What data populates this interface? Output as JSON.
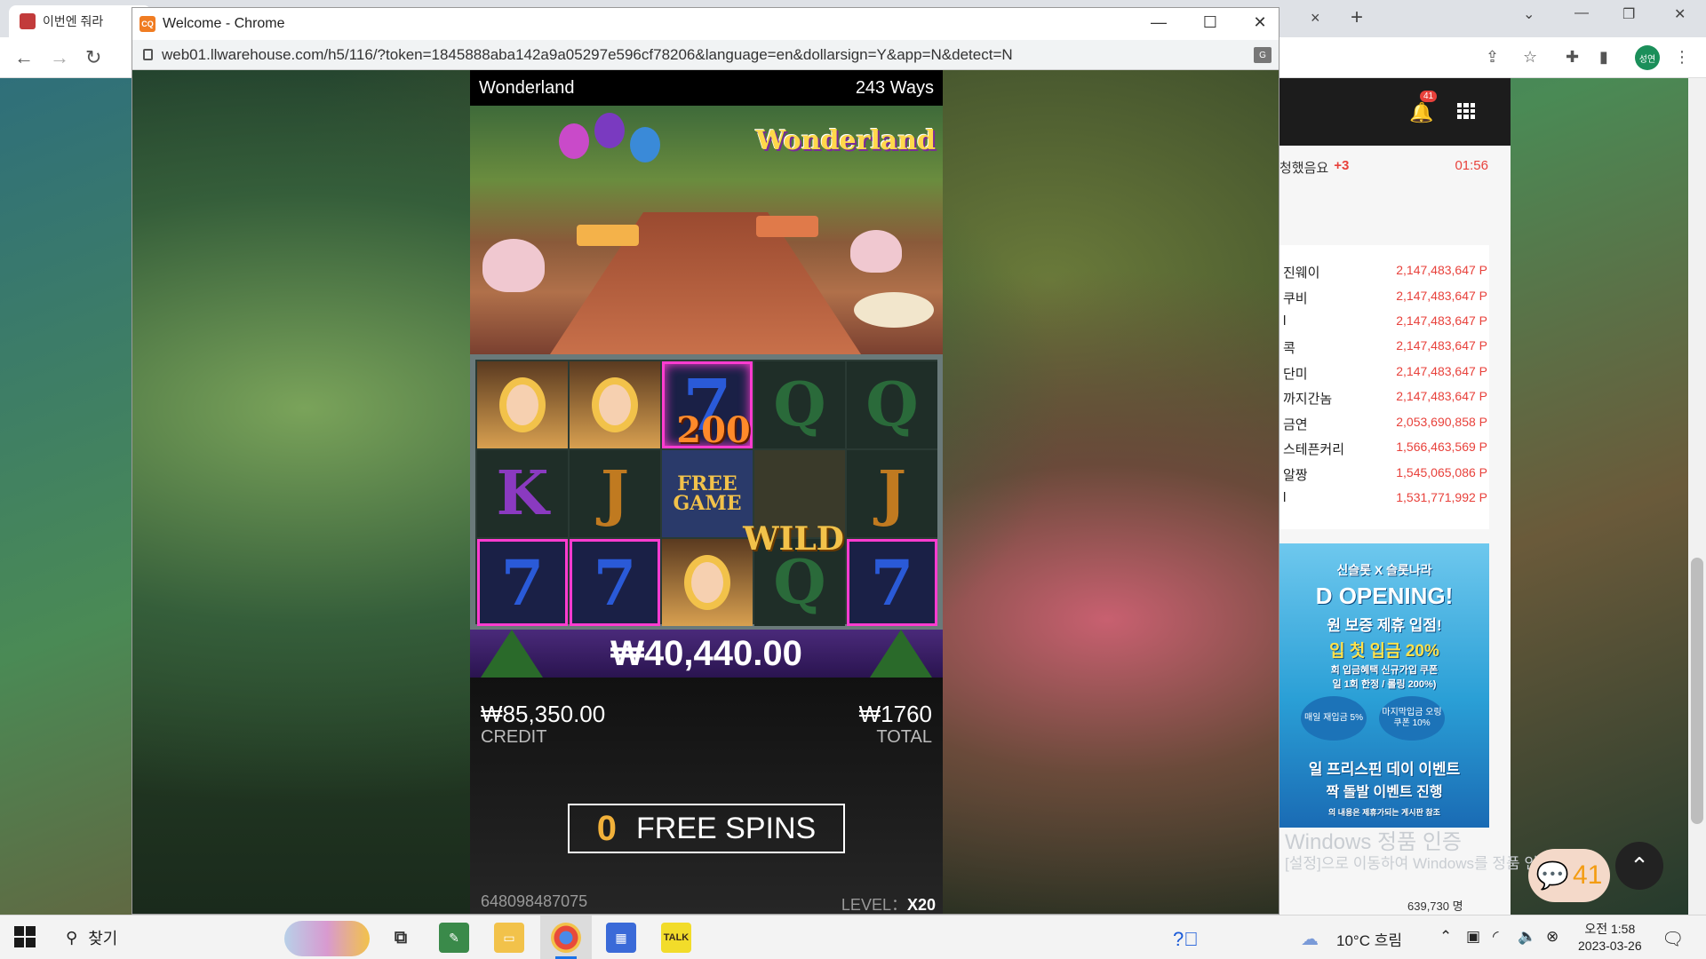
{
  "background_browser": {
    "tab_title": "이번엔 줘라",
    "tab_close": "×",
    "new_tab": "+",
    "nav_back": "←",
    "nav_forward": "→",
    "nav_reload": "↻",
    "avatar_text": "성연",
    "window_minimize": "—",
    "window_restore": "❐",
    "window_close": "✕"
  },
  "site": {
    "notification_count": "41",
    "notice": {
      "text": "청했음요",
      "plus": "+3",
      "time": "01:56"
    },
    "ranking": [
      {
        "name": "진웨이",
        "points": "2,147,483,647 P"
      },
      {
        "name": "쿠비",
        "points": "2,147,483,647 P"
      },
      {
        "name": "l",
        "points": "2,147,483,647 P"
      },
      {
        "name": "콕",
        "points": "2,147,483,647 P"
      },
      {
        "name": "단미",
        "points": "2,147,483,647 P"
      },
      {
        "name": "까지간놈",
        "points": "2,147,483,647 P"
      },
      {
        "name": "금연",
        "points": "2,053,690,858 P"
      },
      {
        "name": "스테픈커리",
        "points": "1,566,463,569 P"
      },
      {
        "name": "알짱",
        "points": "1,545,065,086 P"
      },
      {
        "name": "l",
        "points": "1,531,771,992 P"
      }
    ],
    "banner": {
      "line1": "신슬롯 X 슬롯나라",
      "line2": "D OPENING!",
      "line3": "원 보증 제휴 입점!",
      "line4": "입 첫 입금 20%",
      "line5": "회 입금혜택 신규가입 쿠폰",
      "line6": "일 1회 한정 / 롤링 200%)",
      "circle1": "매일 재입금 5%",
      "circle2": "마지막입금 오링쿠폰 10%",
      "line7": "일 프리스핀 데이 이벤트",
      "line8": "짝 돌발 이벤트 진행",
      "line9": "의 내용은 제휴가되는 게시판 참조"
    },
    "windows_activation_title": "Windows 정품 인증",
    "windows_activation_text": "[설정]으로 이동하여 Windows를 정품 인증합니다.",
    "chat_count": "41",
    "member_count": "639,730 명"
  },
  "popup": {
    "title": "Welcome - Chrome",
    "url": "web01.llwarehouse.com/h5/116/?token=1845888aba142a9a05297e596cf78206&language=en&dollarsign=Y&app=N&detect=N",
    "favicon": "CQ",
    "translate_icon": "G"
  },
  "game": {
    "name": "Wonderland",
    "ways": "243 Ways",
    "logo": "Wonderland",
    "win_amount_small": "200",
    "wild_label": "WILD",
    "free_game_label": "FREE GAME",
    "win_total": "₩40,440.00",
    "credit_value": "₩85,350.00",
    "credit_label": "CREDIT",
    "total_value": "₩1760",
    "total_label": "TOTAL",
    "free_spins_count": "0",
    "free_spins_label": "FREE SPINS",
    "game_id": "648098487075",
    "level_label": "LEVEL：",
    "level_value": "X20",
    "reels": [
      [
        "alice",
        "K",
        "7"
      ],
      [
        "alice",
        "J",
        "7"
      ],
      [
        "7",
        "free",
        "alice"
      ],
      [
        "Q",
        "wild",
        "Q"
      ],
      [
        "Q",
        "J",
        "7"
      ]
    ]
  },
  "taskbar": {
    "search_label": "찾기",
    "weather": "10°C 흐림",
    "time": "오전 1:58",
    "date": "2023-03-26"
  }
}
